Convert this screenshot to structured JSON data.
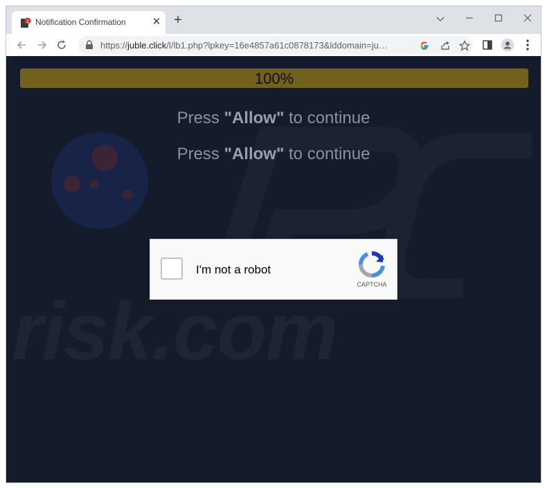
{
  "browser": {
    "tab": {
      "title": "Notification Confirmation",
      "favicon": "warning-page-icon",
      "close_icon": "close-icon"
    },
    "new_tab_icon": "plus-icon",
    "window_controls": [
      "chevron-down-icon",
      "minimize-icon",
      "maximize-icon",
      "close-icon"
    ],
    "address_bar": {
      "scheme": "https://",
      "host": "juble.click",
      "path": "/l/lb1.php?lpkey=16e4857a61c0878173&lddomain=juble.clic..."
    },
    "nav_icons": [
      "back-icon",
      "forward-icon",
      "reload-icon"
    ],
    "omnibox_icons": [
      "google-icon",
      "share-icon",
      "star-icon"
    ],
    "toolbar_icons": [
      "side-panel-icon",
      "profile-icon",
      "menu-icon"
    ]
  },
  "page": {
    "progress": {
      "label": "100%",
      "value": 1.0
    },
    "messages": [
      {
        "prefix": "Press ",
        "emphasis": "\"Allow\"",
        "suffix": " to continue"
      },
      {
        "prefix": "Press ",
        "emphasis": "\"Allow\"",
        "suffix": " to continue"
      }
    ],
    "captcha": {
      "label": "I'm not a robot",
      "brand": "CAPTCHA",
      "checked": false
    },
    "watermark": "risk.com"
  },
  "colors": {
    "page_bg": "#141b2b",
    "progress_fill": "#72611a",
    "message_text": "#8c919a"
  }
}
